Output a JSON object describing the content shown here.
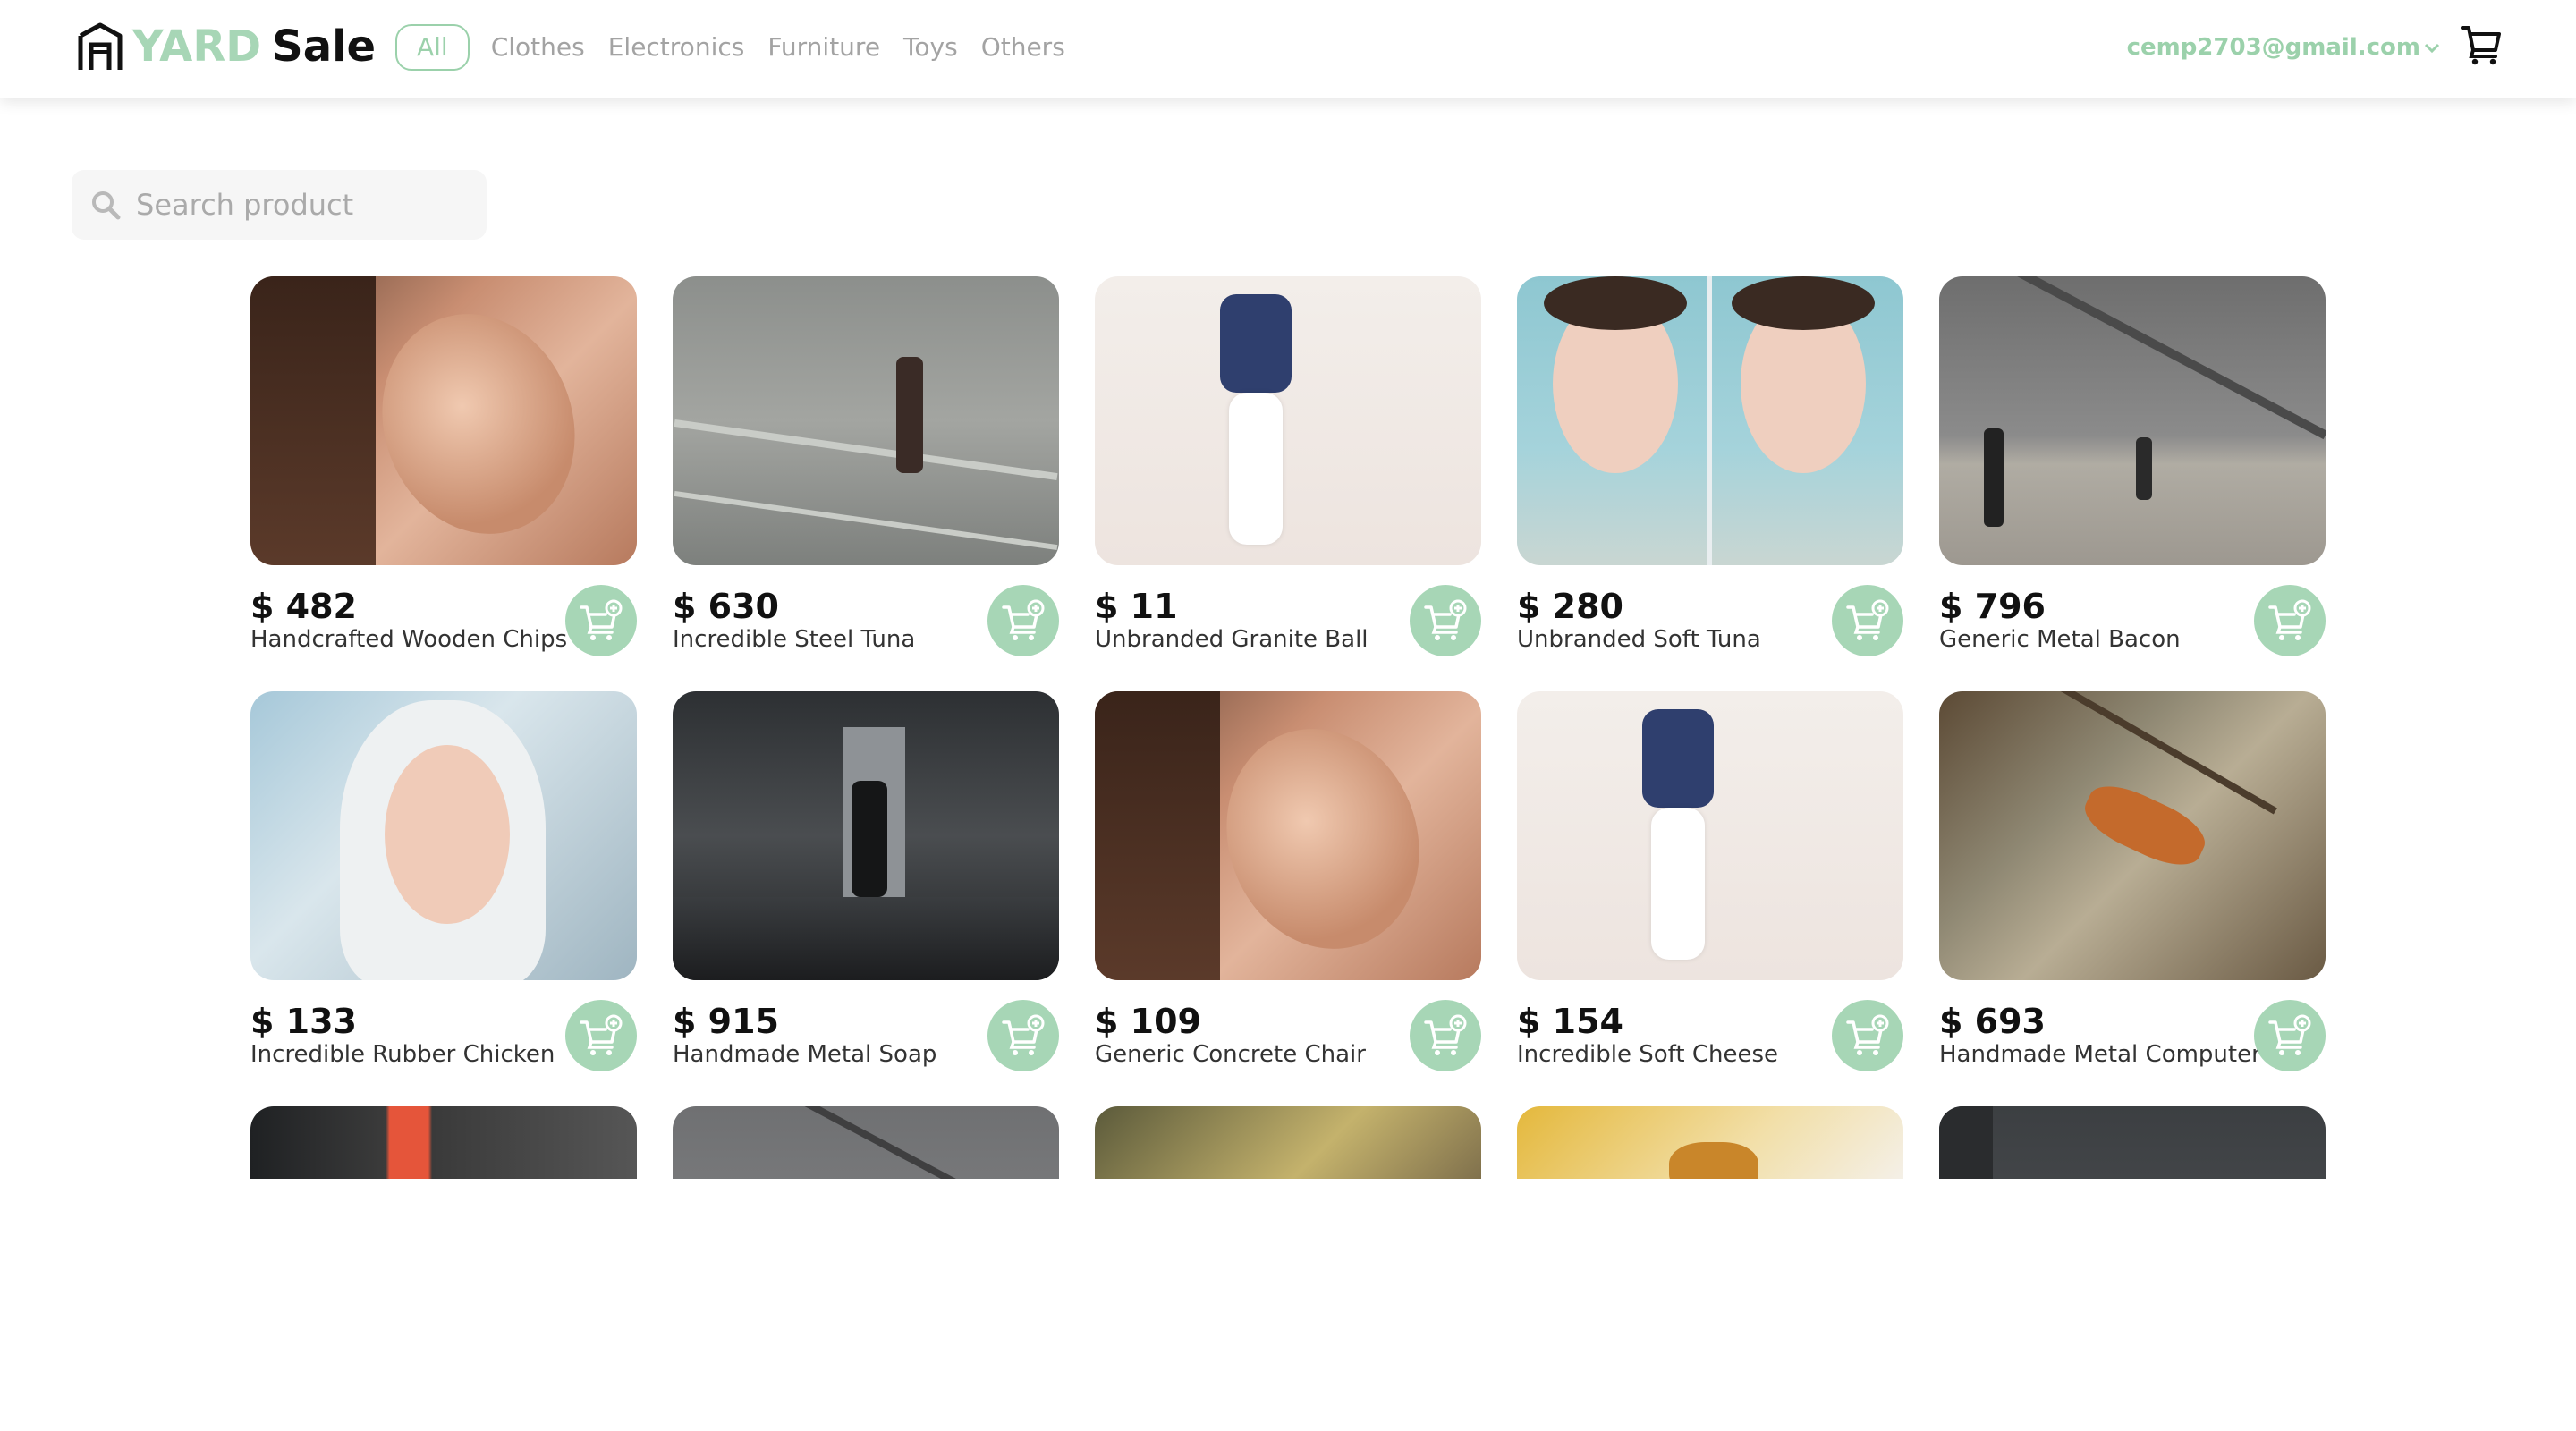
{
  "header": {
    "logo_yard": "YARD",
    "logo_sale": "Sale",
    "categories": [
      "All",
      "Clothes",
      "Electronics",
      "Furniture",
      "Toys",
      "Others"
    ],
    "active_category": "All",
    "user_email": "cemp2703@gmail.com",
    "cart_icon": "shopping-cart-icon"
  },
  "search": {
    "placeholder": "Search product",
    "value": ""
  },
  "products": [
    {
      "price": "$ 482",
      "name": "Handcrafted Wooden Chips"
    },
    {
      "price": "$ 630",
      "name": "Incredible Steel Tuna"
    },
    {
      "price": "$ 11",
      "name": "Unbranded Granite Ball"
    },
    {
      "price": "$ 280",
      "name": "Unbranded Soft Tuna"
    },
    {
      "price": "$ 796",
      "name": "Generic Metal Bacon"
    },
    {
      "price": "$ 133",
      "name": "Incredible Rubber Chicken"
    },
    {
      "price": "$ 915",
      "name": "Handmade Metal Soap"
    },
    {
      "price": "$ 109",
      "name": "Generic Concrete Chair"
    },
    {
      "price": "$ 154",
      "name": "Incredible Soft Cheese"
    },
    {
      "price": "$ 693",
      "name": "Handmade Metal Computer"
    }
  ],
  "colors": {
    "accent": "#a7d6b6",
    "accent_text": "#9bd1ab",
    "muted": "#a3a3a3"
  },
  "icons": {
    "add_to_cart": "add-to-cart-icon",
    "search": "search-icon",
    "dropdown": "chevron-down-icon"
  }
}
